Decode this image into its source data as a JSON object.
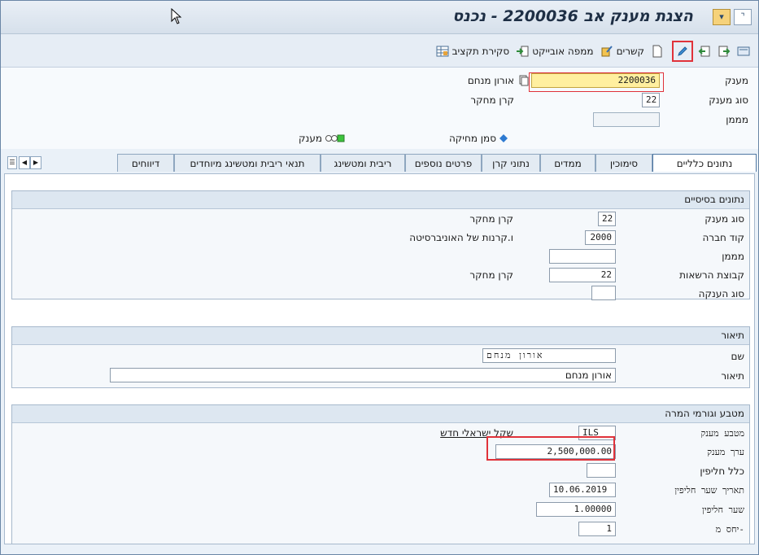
{
  "title": "הצגת מענק אב 2200036 - נכנס",
  "toolbar": {
    "budget_closing": "סקירת תקציב",
    "object_map": "ממפה אובייקט",
    "links": "קשרים"
  },
  "header": {
    "grant_label": "מענק",
    "grant_value": "2200036",
    "grant_desc": "אורון מנחם",
    "grant_type_label": "סוג מענק",
    "grant_type_value": "22",
    "grant_type_desc": "קרן מחקר",
    "sponsor_label": "מממן",
    "sponsor_value": "",
    "legend_delete": "סמן מחיקה",
    "legend_grant": "מענק"
  },
  "tabs": [
    "נתונים כלליים",
    "סימוכין",
    "ממדים",
    "נתוני קרן",
    "פרטים נוספים",
    "ריבית ומטשינג",
    "תנאי ריבית ומטשינג מיוחדים",
    "דיווחים"
  ],
  "basic": {
    "title": "נתונים בסיסיים",
    "grant_type_label": "סוג מענק",
    "grant_type_value": "22",
    "grant_type_desc": "קרן מחקר",
    "company_label": "קוד חברה",
    "company_value": "2000",
    "company_desc": "ו.קרנות של האוניברסיטה",
    "sponsor_label": "מממן",
    "sponsor_value": "",
    "auth_group_label": "קבוצת הרשאות",
    "auth_group_value": "22",
    "auth_group_desc": "קרן מחקר",
    "award_type_label": "סוג הענקה",
    "award_type_value": ""
  },
  "description": {
    "title": "תיאור",
    "name_label": "שם",
    "name_value": "אורון מנחם",
    "desc_label": "תיאור",
    "desc_value": "אורון מנחם"
  },
  "currency": {
    "title": "מטבע וגורמי המרה",
    "currency_label": "מטבע מענק",
    "currency_value": "ILS",
    "currency_desc": "שקל ישראלי חדש",
    "value_label": "ערך מענק",
    "value_value": "2,500,000.00",
    "rule_label": "כלל חליפין",
    "rule_value": "",
    "rate_date_label": "תאריך שער חליפין",
    "rate_date_value": "10.06.2019",
    "rate_label": "שער חליפין",
    "rate_value": "1.00000",
    "ratio_label": "יחס מ-",
    "ratio_value": "1"
  },
  "colors": {
    "highlight": "#e0323a",
    "field_yellow": "#ffef9f",
    "tab_active": "#ffffff"
  }
}
